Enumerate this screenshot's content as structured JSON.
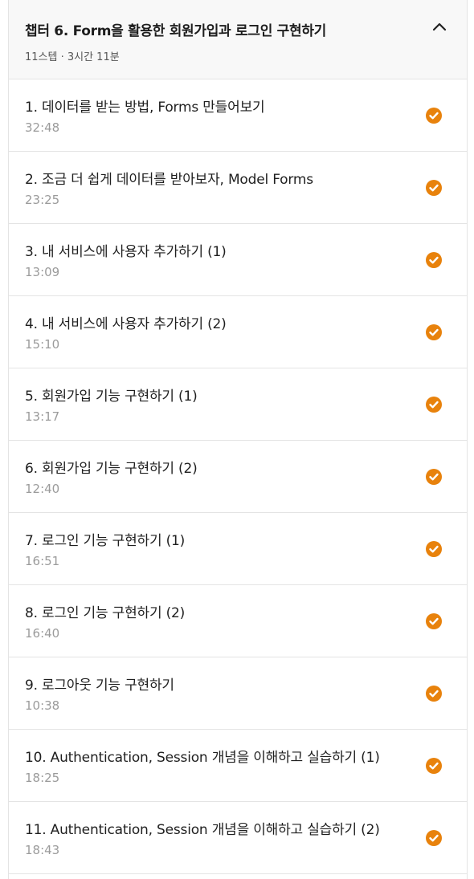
{
  "chapter": {
    "title": "챕터 6. Form을 활용한 회원가입과 로그인 구현하기",
    "meta": "11스텝 · 3시간 11분",
    "toggle_icon": "chevron-up-icon"
  },
  "lessons": [
    {
      "title": "1. 데이터를 받는 방법, Forms 만들어보기",
      "duration": "32:48",
      "completed": true
    },
    {
      "title": "2. 조금 더 쉽게 데이터를 받아보자, Model Forms",
      "duration": "23:25",
      "completed": true
    },
    {
      "title": "3. 내 서비스에 사용자 추가하기 (1)",
      "duration": "13:09",
      "completed": true
    },
    {
      "title": "4. 내 서비스에 사용자 추가하기 (2)",
      "duration": "15:10",
      "completed": true
    },
    {
      "title": "5. 회원가입 기능 구현하기 (1)",
      "duration": "13:17",
      "completed": true
    },
    {
      "title": "6. 회원가입 기능 구현하기 (2)",
      "duration": "12:40",
      "completed": true
    },
    {
      "title": "7. 로그인 기능 구현하기 (1)",
      "duration": "16:51",
      "completed": true
    },
    {
      "title": "8. 로그인 기능 구현하기 (2)",
      "duration": "16:40",
      "completed": true
    },
    {
      "title": "9. 로그아웃 기능 구현하기",
      "duration": "10:38",
      "completed": true
    },
    {
      "title": "10. Authentication, Session 개념을 이해하고 실습하기 (1)",
      "duration": "18:25",
      "completed": true
    },
    {
      "title": "11. Authentication, Session 개념을 이해하고 실습하기 (2)",
      "duration": "18:43",
      "completed": true
    }
  ],
  "colors": {
    "check": "#e8820c",
    "border": "#e4e4e4",
    "duration": "#9b9b9b"
  },
  "icons": {
    "completed": "check-circle-icon"
  }
}
